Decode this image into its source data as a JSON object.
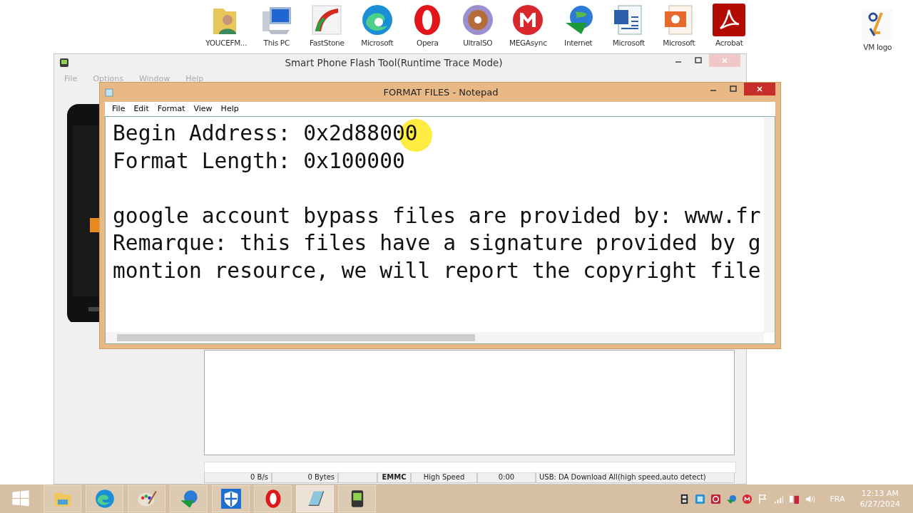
{
  "desktop_icons": [
    {
      "kind": "folder",
      "label": "YOUCEFM..."
    },
    {
      "kind": "pc",
      "label": "This PC"
    },
    {
      "kind": "faststone",
      "label": "FastStone"
    },
    {
      "kind": "edge",
      "label": "Microsoft"
    },
    {
      "kind": "opera",
      "label": "Opera"
    },
    {
      "kind": "disc",
      "label": "UltraISO"
    },
    {
      "kind": "mega",
      "label": "MEGAsync"
    },
    {
      "kind": "idm",
      "label": "Internet"
    },
    {
      "kind": "word",
      "label": "Microsoft"
    },
    {
      "kind": "powerpoint",
      "label": "Microsoft"
    },
    {
      "kind": "acrobat",
      "label": "Acrobat"
    }
  ],
  "corner_icon": {
    "label": "VM logo"
  },
  "flash_tool": {
    "title": "Smart Phone Flash Tool(Runtime Trace Mode)",
    "menu": [
      "File",
      "Options",
      "Window",
      "Help"
    ],
    "progress": {
      "level": 0
    },
    "status_cells": [
      {
        "text": "0 B/s",
        "bold": false
      },
      {
        "text": "0 Bytes",
        "bold": false
      },
      {
        "text": "EMMC",
        "bold": true
      },
      {
        "text": "High Speed",
        "bold": false
      },
      {
        "text": "0:00",
        "bold": false
      },
      {
        "text": "USB: DA Download All(high speed,auto detect)",
        "bold": false
      }
    ]
  },
  "notepad": {
    "title": "FORMAT FILES - Notepad",
    "menu": [
      "File",
      "Edit",
      "Format",
      "View",
      "Help"
    ],
    "header_lines": [
      "Begin Address: 0x2d88000",
      "Format Length: 0x100000"
    ],
    "note_lines": [
      "google account bypass files are provided by: www.fr",
      "Remarque: this files have a signature provided by g",
      "montion resource, we will report the copyright file"
    ]
  },
  "taskbar": {
    "apps": [
      {
        "kind": "explorer",
        "selected": false
      },
      {
        "kind": "edge",
        "selected": false
      },
      {
        "kind": "paint",
        "selected": false
      },
      {
        "kind": "idm",
        "selected": false
      },
      {
        "kind": "shield",
        "selected": false
      },
      {
        "kind": "opera",
        "selected": false
      },
      {
        "kind": "notepad",
        "selected": true
      },
      {
        "kind": "flashtool",
        "selected": false
      }
    ],
    "language": "FRA",
    "time": "12:13 AM",
    "date": "6/27/2024"
  }
}
